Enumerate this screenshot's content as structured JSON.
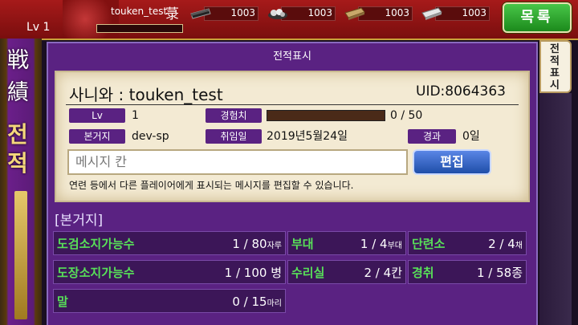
{
  "header": {
    "player_name": "touken_test",
    "crest": "菉",
    "level_label": "Lv 1",
    "resources": [
      {
        "icon": "charcoal-resource-icon",
        "value": "1003"
      },
      {
        "icon": "steel-resource-icon",
        "value": "1003"
      },
      {
        "icon": "cooling-material-resource-icon",
        "value": "1003"
      },
      {
        "icon": "whetstone-resource-icon",
        "value": "1003"
      }
    ],
    "menu_button": "목록"
  },
  "banner": {
    "title_cjk": "戦績",
    "title_kr": "전적"
  },
  "window": {
    "title": "전적표시",
    "side_tab": "전적표시"
  },
  "profile": {
    "name_label": "사니와 : touken_test",
    "uid": "UID:8064363",
    "lv_tag": "Lv",
    "lv_value": "1",
    "exp_tag": "경험치",
    "exp_value": "0 / 50",
    "exp_progress": 0,
    "base_tag": "본거지",
    "base_value": "dev-sp",
    "joined_tag": "취임일",
    "joined_value": "2019년5월24일",
    "elapsed_tag": "경과",
    "elapsed_value": "0일",
    "message_placeholder": "메시지 칸",
    "edit_button": "편집",
    "hint": "연련 등에서 다른 플레이어에게 표시되는 메시지를 편집할 수 있습니다."
  },
  "base_section": {
    "title": "[본거지]",
    "stats": [
      {
        "label": "도검소지가능수",
        "value": "1 / 80",
        "unit": "자루"
      },
      {
        "label": "부대",
        "value": "1 / 4",
        "unit": "부대"
      },
      {
        "label": "단련소",
        "value": "2 / 4",
        "unit": "채"
      },
      {
        "label": "도장소지가능수",
        "value": "1 / 100",
        "unit": "병"
      },
      {
        "label": "수리실",
        "value": "2 / 4",
        "unit": "칸"
      },
      {
        "label": "경취",
        "value": "1 / 58",
        "unit": "종"
      },
      {
        "label": "말",
        "value": "0 / 15",
        "unit": "마리"
      }
    ]
  },
  "colors": {
    "header_red": "#8f1414",
    "panel_purple": "#5a2282",
    "stat_green": "#58e058",
    "edit_blue": "#2a5ec0",
    "menu_green": "#2ea82e"
  }
}
